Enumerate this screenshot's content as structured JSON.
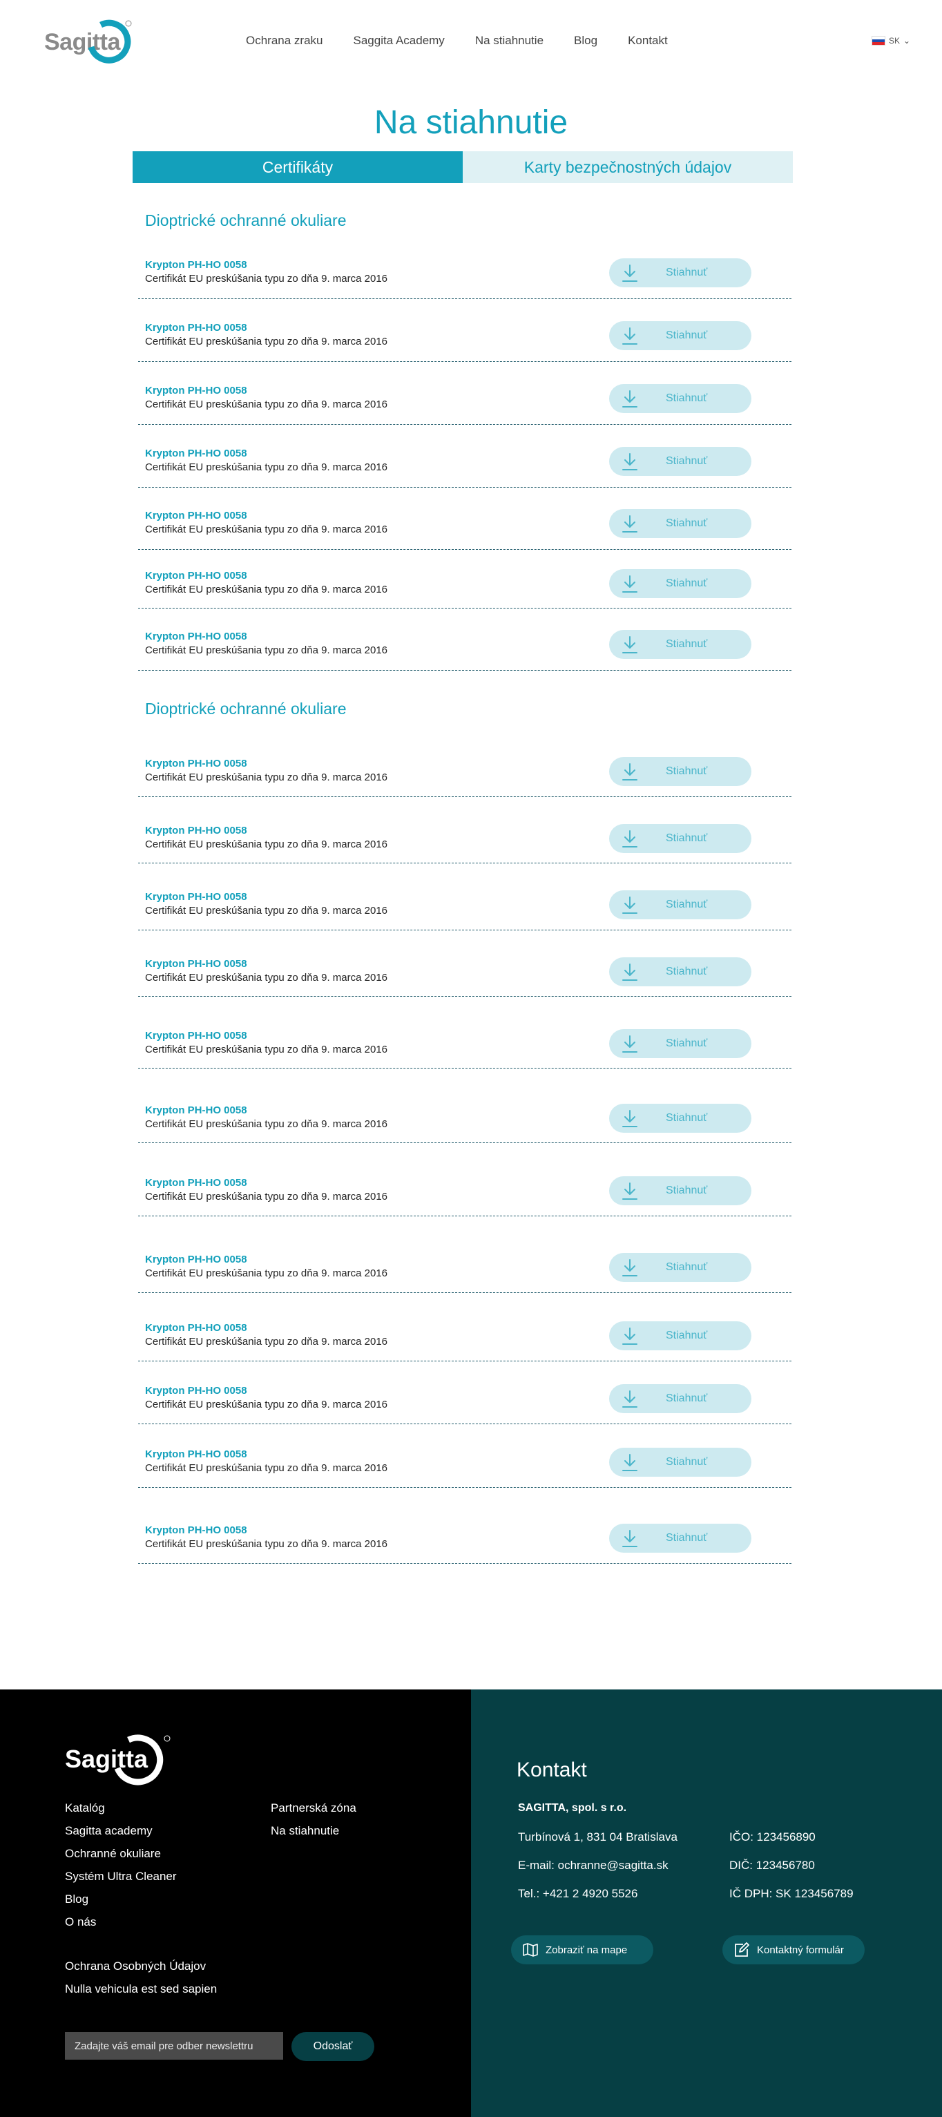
{
  "header": {
    "logo_text": "Sagitta",
    "nav": [
      "Ochrana zraku",
      "Saggita Academy",
      "Na stiahnutie",
      "Blog",
      "Kontakt"
    ],
    "lang": "SK"
  },
  "page_title": "Na stiahnutie",
  "tabs": [
    "Certifikáty",
    "Karty bezpečnostných údajov"
  ],
  "sections": [
    {
      "title": "Dioptrické ochranné okuliare",
      "items": [
        {
          "name": "Krypton PH-HO 0058",
          "desc": "Certifikát EU preskúšania typu zo dňa 9. marca 2016",
          "button": "Stiahnuť"
        },
        {
          "name": "Krypton PH-HO 0058",
          "desc": "Certifikát EU preskúšania typu zo dňa 9. marca 2016",
          "button": "Stiahnuť"
        },
        {
          "name": "Krypton PH-HO 0058",
          "desc": "Certifikát EU preskúšania typu zo dňa 9. marca 2016",
          "button": "Stiahnuť"
        },
        {
          "name": "Krypton PH-HO 0058",
          "desc": "Certifikát EU preskúšania typu zo dňa 9. marca 2016",
          "button": "Stiahnuť"
        },
        {
          "name": "Krypton PH-HO 0058",
          "desc": "Certifikát EU preskúšania typu zo dňa 9. marca 2016",
          "button": "Stiahnuť"
        },
        {
          "name": "Krypton PH-HO 0058",
          "desc": "Certifikát EU preskúšania typu zo dňa 9. marca 2016",
          "button": "Stiahnuť"
        },
        {
          "name": "Krypton PH-HO 0058",
          "desc": "Certifikát EU preskúšania typu zo dňa 9. marca 2016",
          "button": "Stiahnuť"
        }
      ]
    },
    {
      "title": "Dioptrické ochranné okuliare",
      "items": [
        {
          "name": "Krypton PH-HO 0058",
          "desc": "Certifikát EU preskúšania typu zo dňa 9. marca 2016",
          "button": "Stiahnuť"
        },
        {
          "name": "Krypton PH-HO 0058",
          "desc": "Certifikát EU preskúšania typu zo dňa 9. marca 2016",
          "button": "Stiahnuť"
        },
        {
          "name": "Krypton PH-HO 0058",
          "desc": "Certifikát EU preskúšania typu zo dňa 9. marca 2016",
          "button": "Stiahnuť"
        },
        {
          "name": "Krypton PH-HO 0058",
          "desc": "Certifikát EU preskúšania typu zo dňa 9. marca 2016",
          "button": "Stiahnuť"
        },
        {
          "name": "Krypton PH-HO 0058",
          "desc": "Certifikát EU preskúšania typu zo dňa 9. marca 2016",
          "button": "Stiahnuť"
        },
        {
          "name": "Krypton PH-HO 0058",
          "desc": "Certifikát EU preskúšania typu zo dňa 9. marca 2016",
          "button": "Stiahnuť"
        },
        {
          "name": "Krypton PH-HO 0058",
          "desc": "Certifikát EU preskúšania typu zo dňa 9. marca 2016",
          "button": "Stiahnuť"
        },
        {
          "name": "Krypton PH-HO 0058",
          "desc": "Certifikát EU preskúšania typu zo dňa 9. marca 2016",
          "button": "Stiahnuť"
        },
        {
          "name": "Krypton PH-HO 0058",
          "desc": "Certifikát EU preskúšania typu zo dňa 9. marca 2016",
          "button": "Stiahnuť"
        },
        {
          "name": "Krypton PH-HO 0058",
          "desc": "Certifikát EU preskúšania typu zo dňa 9. marca 2016",
          "button": "Stiahnuť"
        },
        {
          "name": "Krypton PH-HO 0058",
          "desc": "Certifikát EU preskúšania typu zo dňa 9. marca 2016",
          "button": "Stiahnuť"
        },
        {
          "name": "Krypton PH-HO 0058",
          "desc": "Certifikát EU preskúšania typu zo dňa 9. marca 2016",
          "button": "Stiahnuť"
        }
      ]
    }
  ],
  "footer": {
    "logo_text": "Sagitta",
    "col1": [
      "Katalóg",
      "Sagitta academy",
      "Ochranné okuliare",
      "Systém Ultra Cleaner",
      "Blog",
      "O nás"
    ],
    "col2": [
      "Partnerská zóna",
      "Na stiahnutie"
    ],
    "legal": [
      "Ochrana Osobných Údajov",
      "Nulla vehicula est sed sapien"
    ],
    "newsletter_placeholder": "Zadajte váš email pre odber newslettru",
    "newsletter_button": "Odoslať",
    "contact": {
      "title": "Kontakt",
      "company": "SAGITTA, spol. s r.o.",
      "address": "Turbínová 1, 831 04  Bratislava",
      "email": "E-mail: ochranne@sagitta.sk",
      "phone": "Tel.: +421 2 4920 5526",
      "ico": "IČO: 123456890",
      "dic": "DIČ: 123456780",
      "icdph": "IČ DPH: SK 123456789",
      "map_button": "Zobraziť na mape",
      "form_button": "Kontaktný formulár"
    }
  },
  "colors": {
    "accent": "#13a0bb",
    "footer_dark": "#063f44",
    "button_bg": "#cdeaf0"
  }
}
